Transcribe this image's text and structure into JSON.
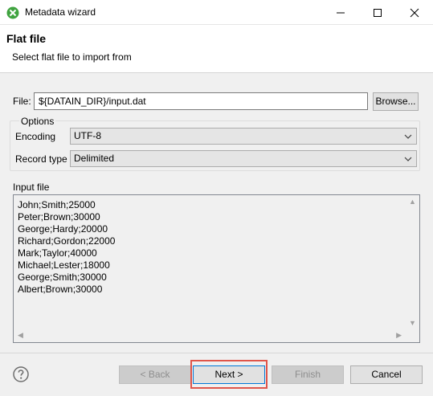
{
  "window": {
    "title": "Metadata wizard",
    "icon": "metadata-wizard-icon",
    "controls": [
      "minimize-icon",
      "maximize-icon",
      "close-icon"
    ]
  },
  "banner": {
    "title": "Flat file",
    "description": "Select flat file to import from"
  },
  "file": {
    "label": "File:",
    "value": "${DATAIN_DIR}/input.dat",
    "browse_label": "Browse..."
  },
  "options": {
    "group_label": "Options",
    "encoding_label": "Encoding",
    "encoding_value": "UTF-8",
    "record_type_label": "Record type",
    "record_type_value": "Delimited"
  },
  "input_file": {
    "label": "Input file",
    "lines": [
      "John;Smith;25000",
      "Peter;Brown;30000",
      "George;Hardy;20000",
      "Richard;Gordon;22000",
      "Mark;Taylor;40000",
      "Michael;Lester;18000",
      "George;Smith;30000",
      "Albert;Brown;30000"
    ]
  },
  "footer": {
    "help_icon": "help-icon",
    "back_label": "< Back",
    "next_label": "Next >",
    "finish_label": "Finish",
    "cancel_label": "Cancel"
  },
  "colors": {
    "highlight": "#e0554a",
    "app_icon": "#3fa33f",
    "focus_border": "#0078d7"
  }
}
